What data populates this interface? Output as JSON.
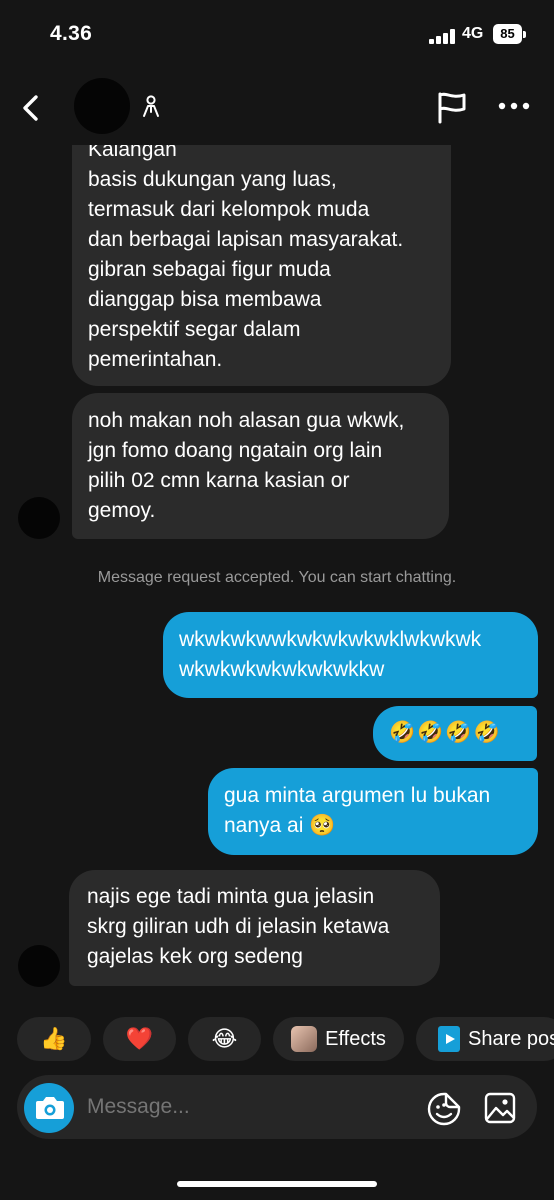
{
  "status_bar": {
    "time": "4.36",
    "network": "4G",
    "battery": "85"
  },
  "header": {
    "back_icon": "chevron-left-icon",
    "user_icon": "person-icon",
    "flag_icon": "flag-icon",
    "more_icon": "more-horizontal-icon"
  },
  "messages": [
    {
      "side": "in",
      "text": "Kalangan\nbasis dukungan yang luas,\ntermasuk dari kelompok muda\ndan berbagai lapisan masyarakat.\ngibran sebagai figur muda\ndianggap bisa membawa\nperspektif segar dalam\npemerintahan."
    },
    {
      "side": "in",
      "text": "noh makan noh alasan gua wkwk,\njgn fomo doang ngatain org lain\npilih 02 cmn karna kasian or\ngemoy."
    },
    {
      "side": "out",
      "text": "wkwkwkwwkwkwkwkwklwkwkwk\nwkwkwkwkwkwkwkkw"
    },
    {
      "side": "out",
      "text": "🤣🤣🤣🤣"
    },
    {
      "side": "out",
      "text": "gua minta argumen lu bukan\nnanya ai 🥺"
    },
    {
      "side": "in",
      "text": "najis ege tadi minta gua jelasin\nskrg giliran udh di jelasin ketawa\ngajelas kek org sedeng"
    }
  ],
  "system_note": "Message request accepted. You can start chatting.",
  "quick_reactions": [
    {
      "emoji": "👍"
    },
    {
      "emoji": "❤️"
    },
    {
      "emoji": "😂"
    },
    {
      "icon": "effects-thumbnail",
      "label": "Effects"
    },
    {
      "icon": "share-post-icon",
      "label": "Share pos"
    }
  ],
  "composer": {
    "placeholder": "Message...",
    "camera_icon": "camera-icon",
    "sticker_icon": "sticker-icon",
    "gallery_icon": "gallery-icon"
  },
  "colors": {
    "background": "#151515",
    "incoming_bubble": "#2b2b2b",
    "outgoing_bubble": "#169fd8",
    "system_text": "#9a9a9a"
  }
}
